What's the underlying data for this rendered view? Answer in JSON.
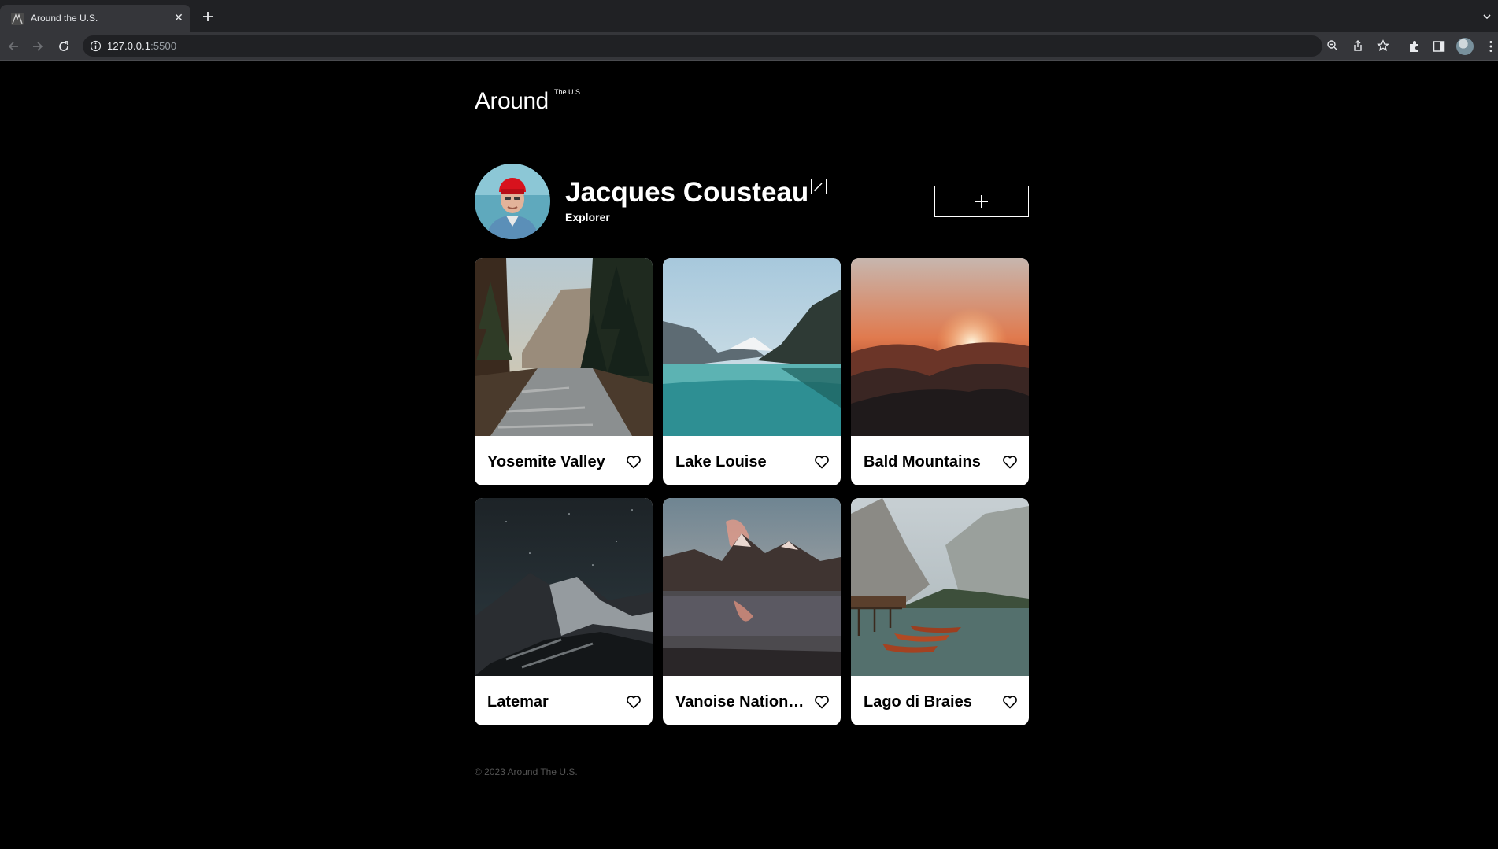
{
  "browser": {
    "tab_title": "Around the U.S.",
    "url_host": "127.0.0.1",
    "url_port": ":5500"
  },
  "header": {
    "logo": "Around",
    "logo_sup": "The U.S."
  },
  "profile": {
    "name": "Jacques Cousteau",
    "job": "Explorer"
  },
  "cards": [
    {
      "title": "Yosemite Valley"
    },
    {
      "title": "Lake Louise"
    },
    {
      "title": "Bald Mountains"
    },
    {
      "title": "Latemar"
    },
    {
      "title": "Vanoise National Park"
    },
    {
      "title": "Lago di Braies"
    }
  ],
  "footer": {
    "copyright": "© 2023 Around The U.S."
  },
  "icons": {
    "edit": "pencil-edit-icon",
    "add": "plus-icon",
    "like": "heart-outline-icon"
  },
  "colors": {
    "page_background": "#000000",
    "card_background": "#ffffff",
    "divider": "#545454",
    "footer_text": "#545454"
  }
}
